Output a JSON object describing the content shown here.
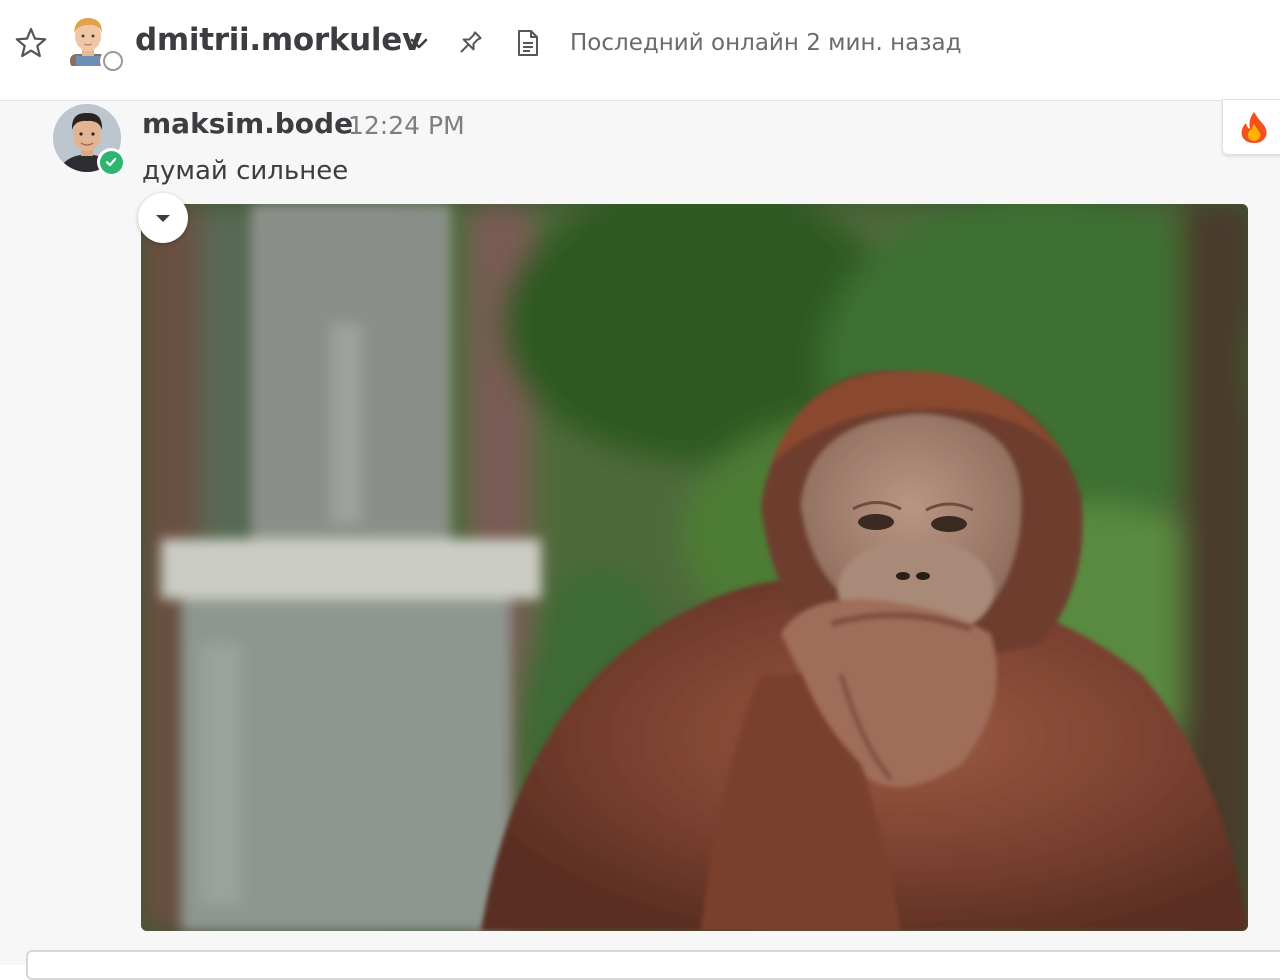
{
  "header": {
    "username": "dmitrii.morkulev",
    "last_seen": "Последний онлайн 2 мин. назад",
    "icons": {
      "favorite": "star-icon",
      "dropdown": "chevron-down-icon",
      "pinned": "pin-icon",
      "files": "document-icon",
      "presence": "offline-status-icon"
    }
  },
  "post": {
    "author": "maksim.bode",
    "time": "12:24 PM",
    "message": "думай сильнее",
    "author_status": "online",
    "reaction_emoji": "🔥",
    "attachment": {
      "kind": "image",
      "subject": "orangutan photo",
      "collapse_icon": "caret-down-icon"
    }
  },
  "colors": {
    "text": "#3d3c40",
    "muted": "#7d7d82",
    "online": "#2eb670",
    "channel_bg": "#f7f7f7"
  }
}
